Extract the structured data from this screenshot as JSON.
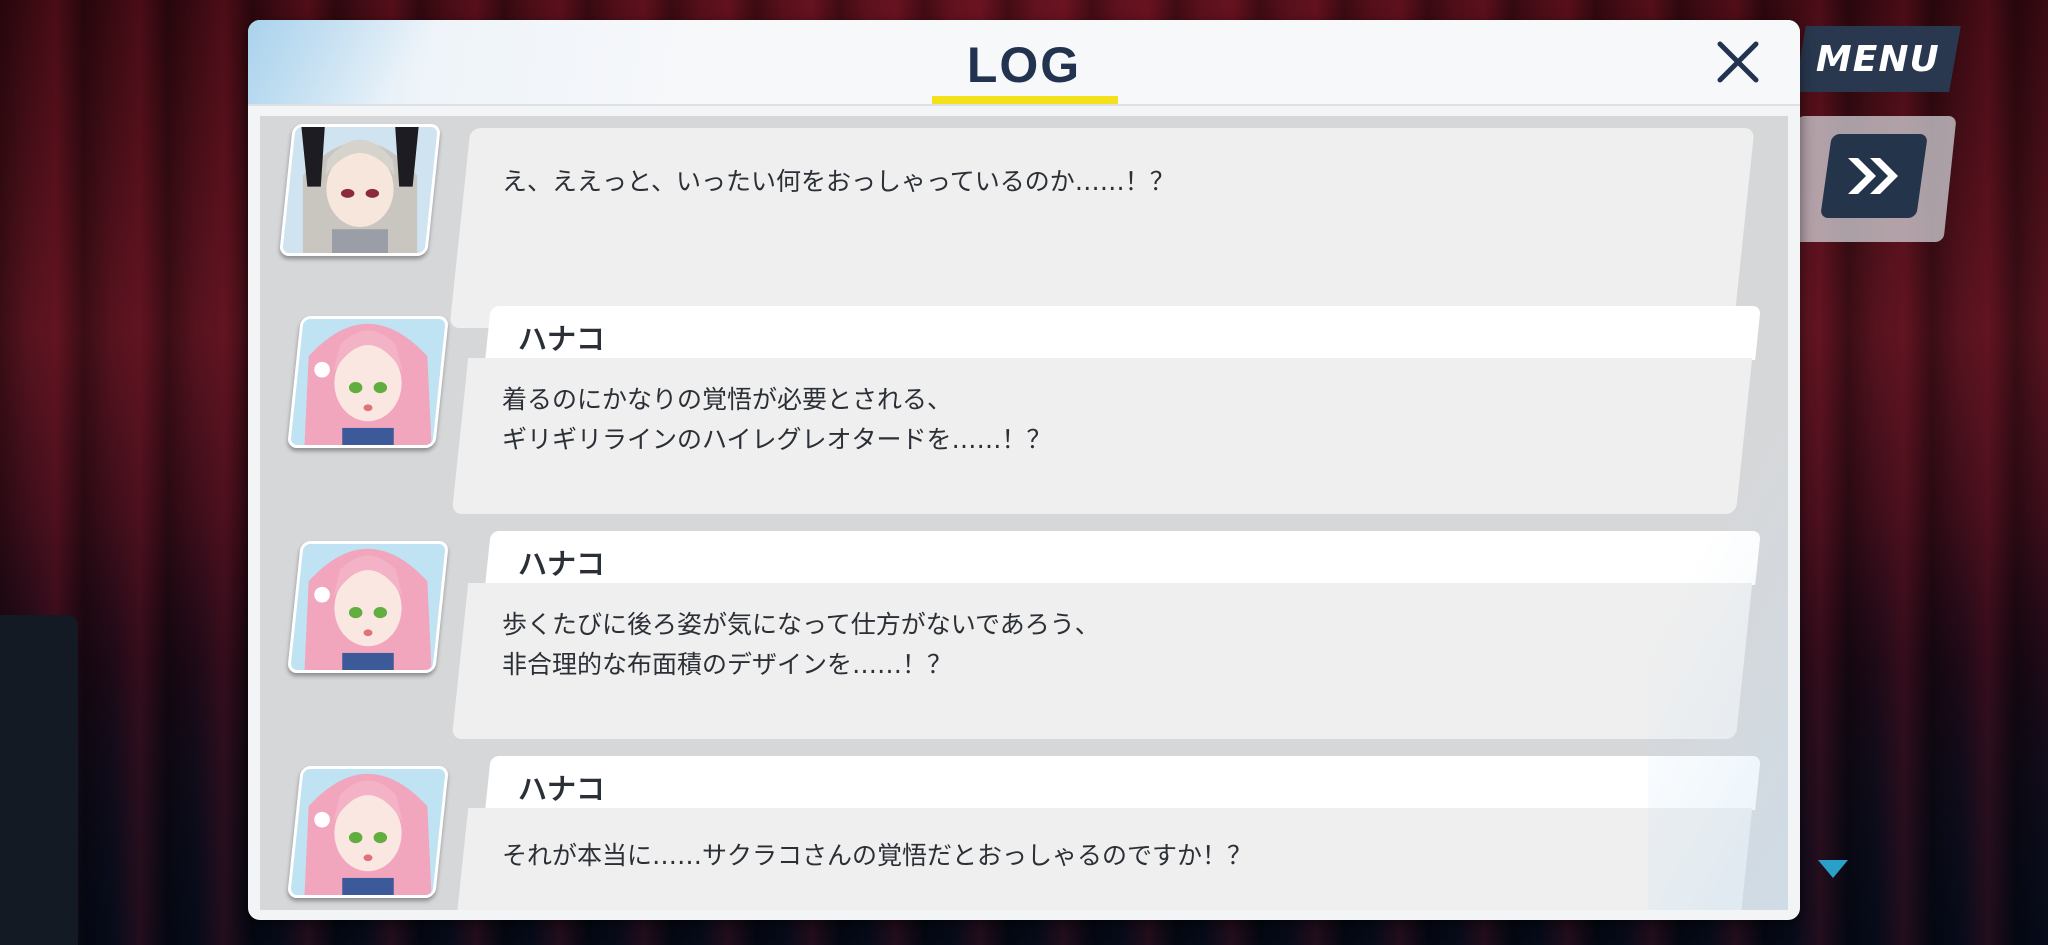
{
  "hud": {
    "menu_label": "MENU",
    "fast_forward_icon": "double-chevron-right-icon"
  },
  "log": {
    "title": "LOG",
    "close_icon": "close-icon",
    "entries": [
      {
        "speaker": "",
        "portrait": "gray-haired-girl",
        "text": "え、ええっと、いったい何をおっしゃっているのか……！？"
      },
      {
        "speaker": "ハナコ",
        "portrait": "pink-haired-girl",
        "text": "着るのにかなりの覚悟が必要とされる、\nギリギリラインのハイレグレオタードを……！？"
      },
      {
        "speaker": "ハナコ",
        "portrait": "pink-haired-girl",
        "text": "歩くたびに後ろ姿が気になって仕方がないであろう、\n非合理的な布面積のデザインを……！？"
      },
      {
        "speaker": "ハナコ",
        "portrait": "pink-haired-girl",
        "text": "それが本当に……サクラコさんの覚悟だとおっしゃるのですか！？"
      }
    ]
  },
  "colors": {
    "accent_yellow": "#f5e11a",
    "title_navy": "#223350",
    "menu_bg": "#29384f"
  }
}
